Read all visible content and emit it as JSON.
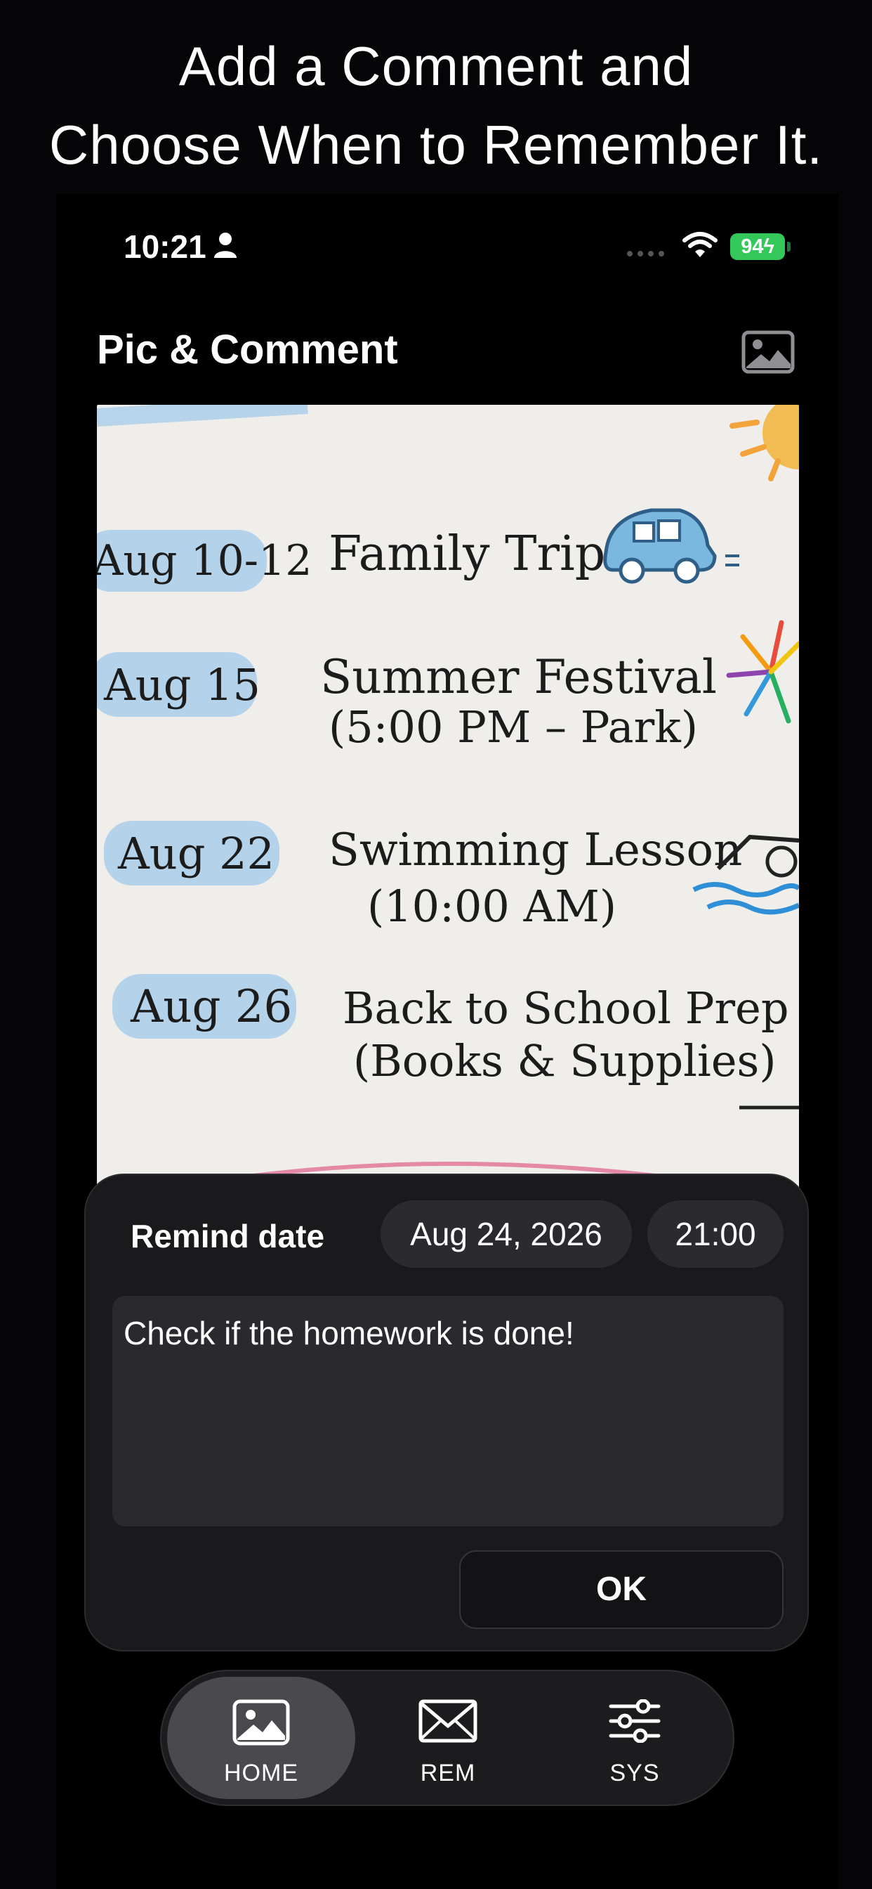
{
  "headline": {
    "line1": "Add a Comment and",
    "line2": "Choose When to Remember It."
  },
  "status_bar": {
    "time": "10:21",
    "battery": "94",
    "icons": [
      "person-icon",
      "signal-icon",
      "wifi-icon",
      "battery-icon"
    ]
  },
  "header": {
    "title": "Pic & Comment",
    "image_button_icon": "image-icon"
  },
  "photo": {
    "events": [
      {
        "date": "Aug 10-12",
        "line1": "Family Trip",
        "line2": ""
      },
      {
        "date": "Aug 15",
        "line1": "Summer Festival",
        "line2": "(5:00 PM – Park)"
      },
      {
        "date": "Aug 22",
        "line1": "Swimming Lesson",
        "line2": "(10:00 AM)"
      },
      {
        "date": "Aug 26",
        "line1": "Back to School Prep",
        "line2": "(Books & Supplies)"
      }
    ]
  },
  "remind": {
    "label": "Remind date",
    "date": "Aug 24, 2026",
    "time": "21:00",
    "comment": "Check if the homework is done!",
    "ok_label": "OK"
  },
  "tabs": [
    {
      "label": "HOME",
      "icon": "image-icon",
      "active": true
    },
    {
      "label": "REM",
      "icon": "envelope-icon",
      "active": false
    },
    {
      "label": "SYS",
      "icon": "sliders-icon",
      "active": false
    }
  ],
  "colors": {
    "background": "#000000",
    "panel": "#1a1a1d",
    "pill": "#2b2b2f",
    "battery": "#34c759",
    "active_tab": "#4a4a4e",
    "date_tag": "#a9cdea"
  }
}
